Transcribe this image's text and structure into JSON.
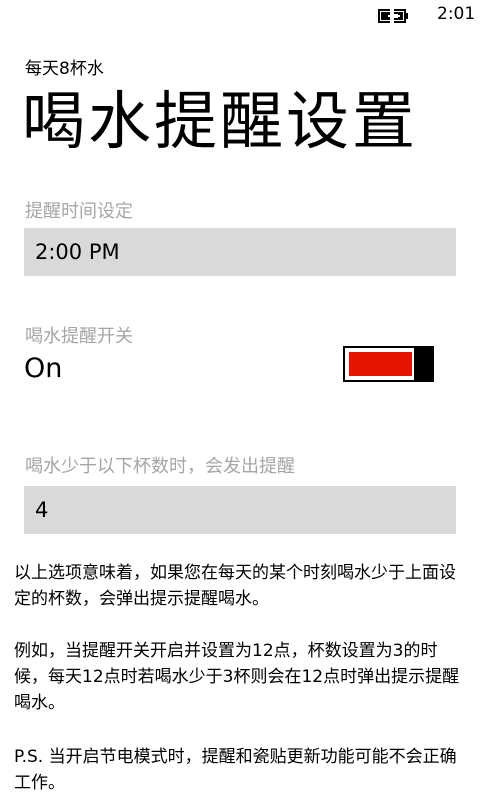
{
  "status_bar": {
    "time": "2:01",
    "battery_icon": "battery-charging-icon"
  },
  "header": {
    "app_title": "每天8杯水",
    "page_title": "喝水提醒设置"
  },
  "reminder_time": {
    "label": "提醒时间设定",
    "value": "2:00 PM"
  },
  "reminder_toggle": {
    "label": "喝水提醒开关",
    "state_text": "On",
    "is_on": true,
    "accent_color": "#e51400"
  },
  "cup_threshold": {
    "label": "喝水少于以下杯数时，会发出提醒",
    "value": "4"
  },
  "description": {
    "p1": "以上选项意味着，如果您在每天的某个时刻喝水少于上面设定的杯数，会弹出提示提醒喝水。",
    "p2": "例如，当提醒开关开启并设置为12点，杯数设置为3的时候，每天12点时若喝水少于3杯则会在12点时弹出提示提醒喝水。",
    "p3": "P.S. 当开启节电模式时，提醒和瓷贴更新功能可能不会正确工作。"
  }
}
